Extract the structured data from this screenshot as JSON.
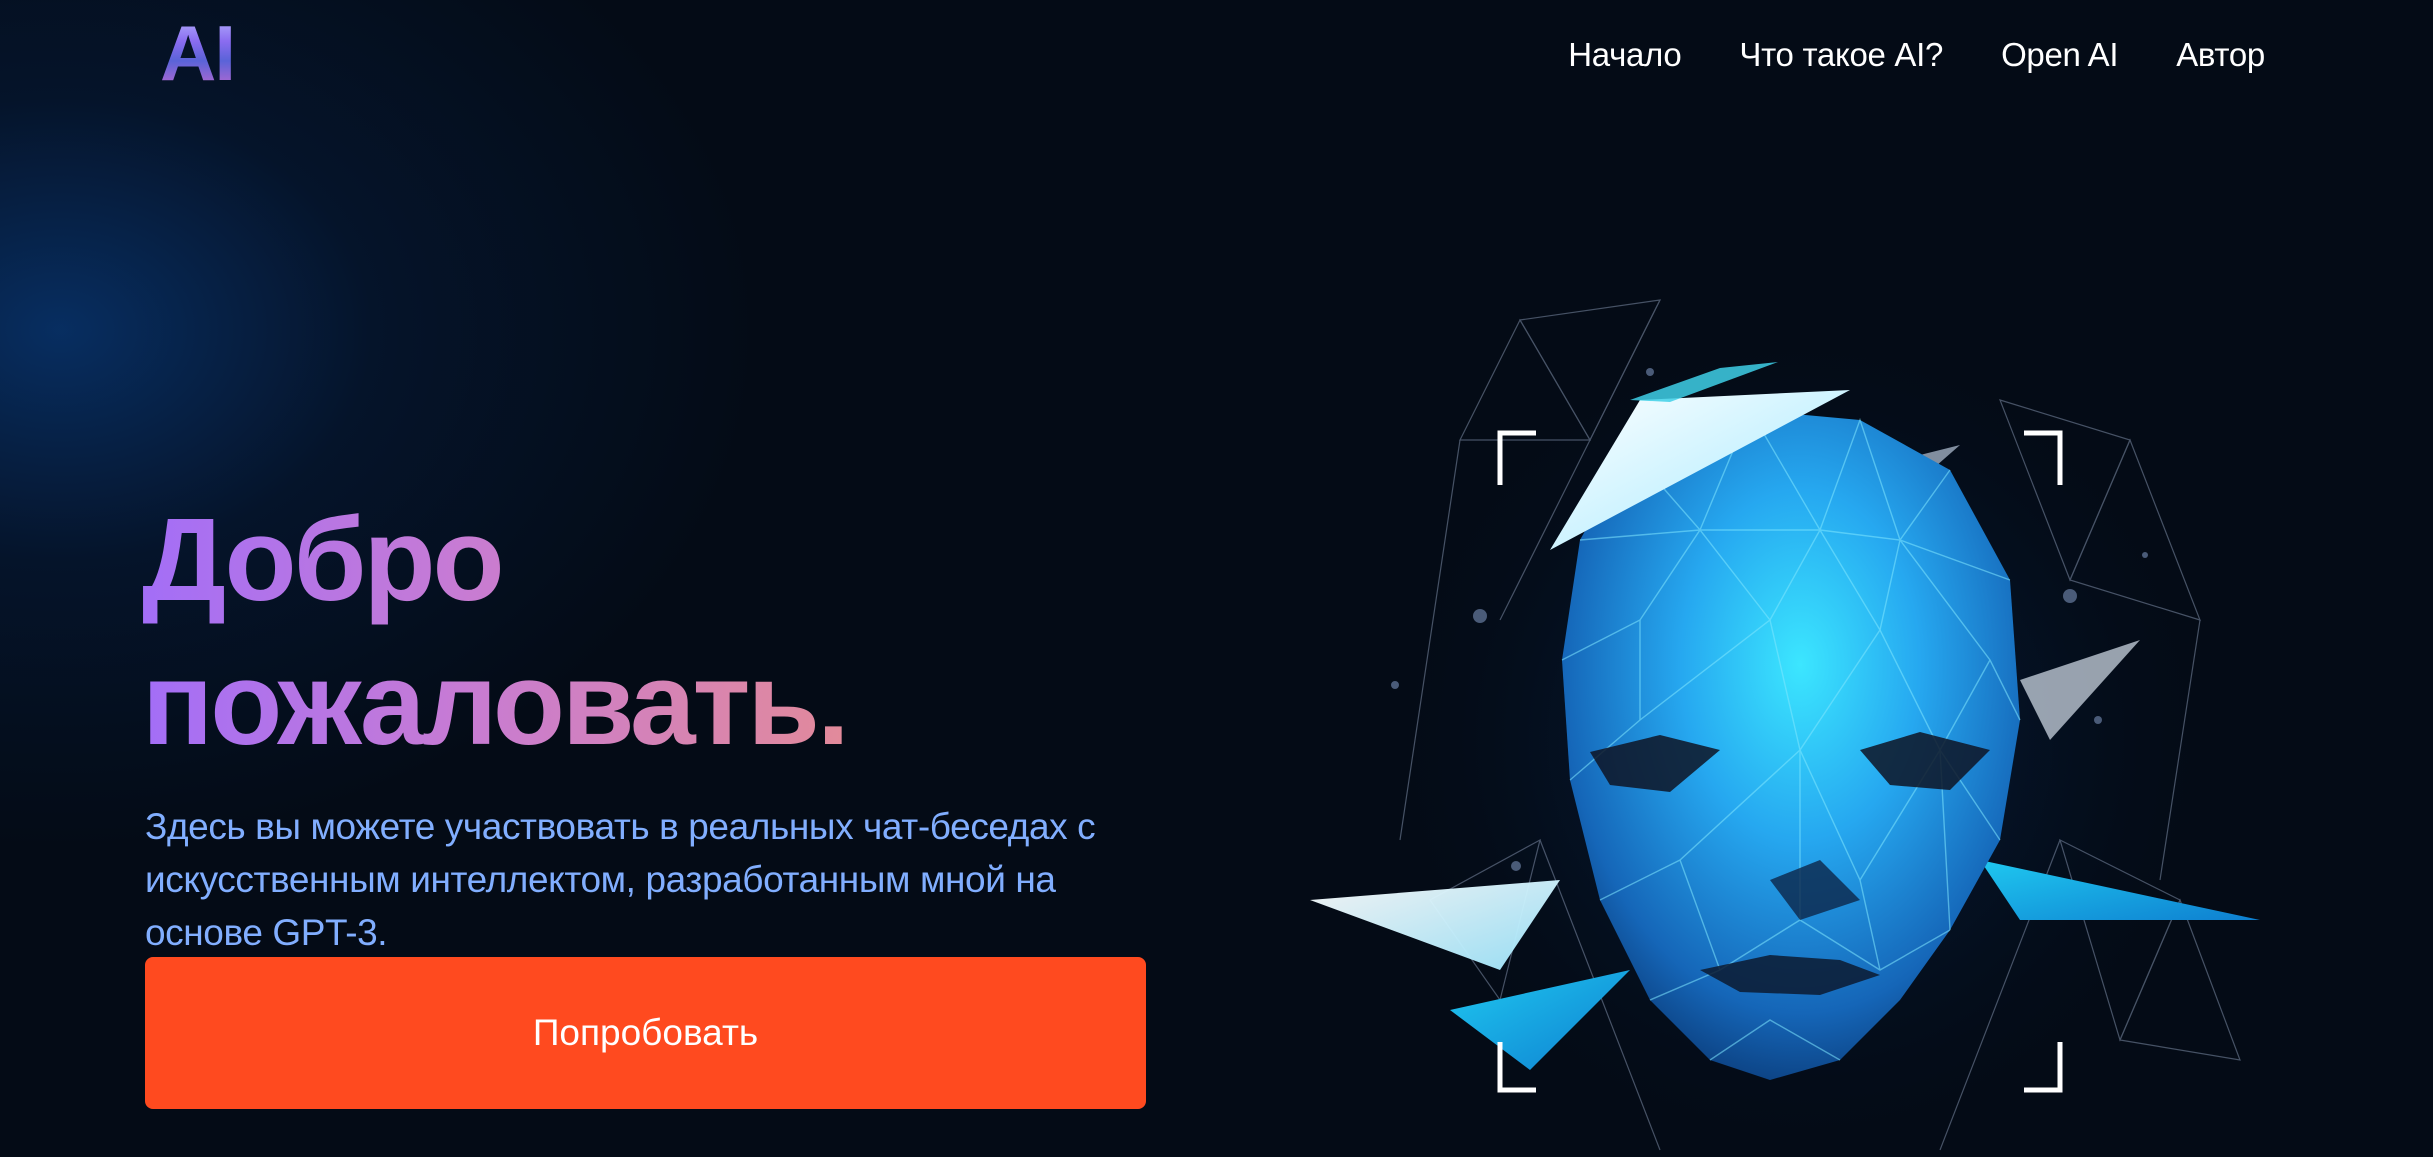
{
  "header": {
    "logo_text": "AI",
    "nav": [
      {
        "label": "Начало"
      },
      {
        "label": "Что такое AI?"
      },
      {
        "label": "Open AI"
      },
      {
        "label": "Автор"
      }
    ]
  },
  "hero": {
    "title_line1": "Добро",
    "title_line2": "пожаловать.",
    "description": "Здесь вы можете участвовать в реальных чат-беседах с искусственным интеллектом, разработанным мной на основе GPT-3.",
    "cta_label": "Попробовать",
    "illustration_icon": "low-poly-ai-face-icon"
  },
  "colors": {
    "background": "#040b16",
    "accent": "#ff4a1f",
    "title_gradient_start": "#a36ef7",
    "title_gradient_end": "#e28a9a",
    "description": "#81aeff"
  }
}
